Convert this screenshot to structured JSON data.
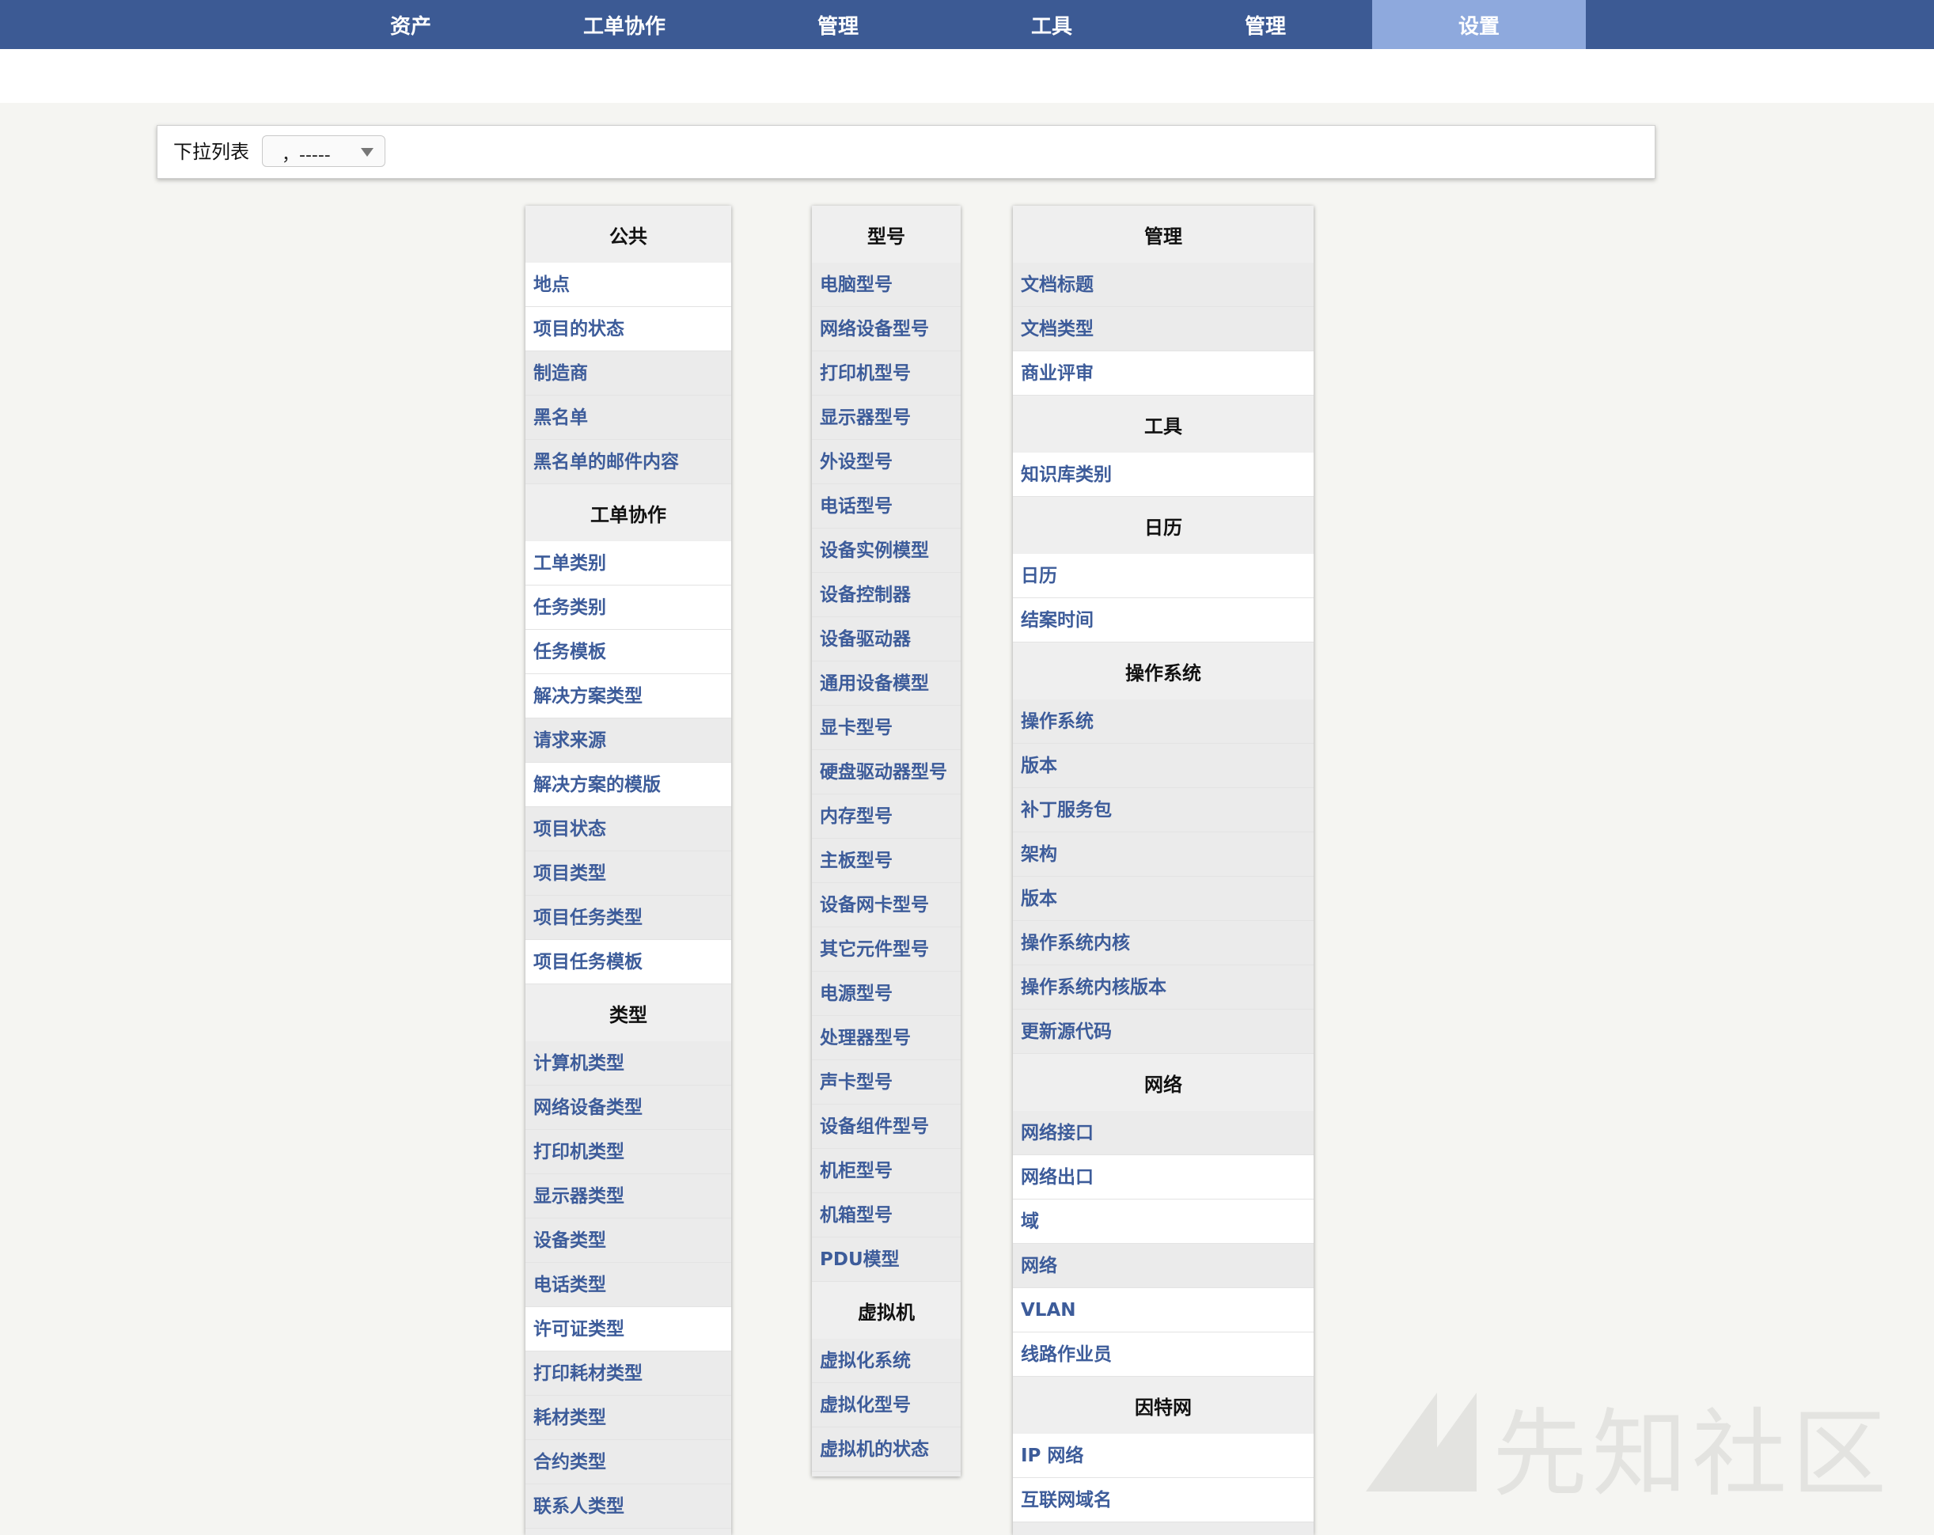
{
  "nav": {
    "items": [
      "资产",
      "工单协作",
      "管理",
      "工具",
      "管理",
      "设置"
    ],
    "active_index": 5
  },
  "dropdown": {
    "label": "下拉列表",
    "value": "，-----"
  },
  "columns": [
    {
      "sections": [
        {
          "title": "公共",
          "items": [
            "地点",
            "项目的状态",
            "制造商",
            "黑名单",
            "黑名单的邮件内容"
          ]
        },
        {
          "title": "工单协作",
          "items": [
            "工单类别",
            "任务类别",
            "任务模板",
            "解决方案类型",
            "请求来源",
            "解决方案的模版",
            "项目状态",
            "项目类型",
            "项目任务类型",
            "项目任务模板"
          ]
        },
        {
          "title": "类型",
          "items": [
            "计算机类型",
            "网络设备类型",
            "打印机类型",
            "显示器类型",
            "设备类型",
            "电话类型",
            "许可证类型",
            "打印耗材类型",
            "耗材类型",
            "合约类型",
            "联系人类型"
          ]
        }
      ]
    },
    {
      "sections": [
        {
          "title": "型号",
          "items": [
            "电脑型号",
            "网络设备型号",
            "打印机型号",
            "显示器型号",
            "外设型号",
            "电话型号",
            "设备实例模型",
            "设备控制器",
            "设备驱动器",
            "通用设备模型",
            "显卡型号",
            "硬盘驱动器型号",
            "内存型号",
            "主板型号",
            "设备网卡型号",
            "其它元件型号",
            "电源型号",
            "处理器型号",
            "声卡型号",
            "设备组件型号",
            "机柜型号",
            "机箱型号",
            "PDU模型"
          ]
        },
        {
          "title": "虚拟机",
          "items": [
            "虚拟化系统",
            "虚拟化型号",
            "虚拟机的状态"
          ]
        }
      ]
    },
    {
      "sections": [
        {
          "title": "管理",
          "items": [
            "文档标题",
            "文档类型",
            "商业评审"
          ]
        },
        {
          "title": "工具",
          "items": [
            "知识库类别"
          ]
        },
        {
          "title": "日历",
          "items": [
            "日历",
            "结案时间"
          ]
        },
        {
          "title": "操作系统",
          "items": [
            "操作系统",
            "版本",
            "补丁服务包",
            "架构",
            "版本",
            "操作系统内核",
            "操作系统内核版本",
            "更新源代码"
          ]
        },
        {
          "title": "网络",
          "items": [
            "网络接口",
            "网络出口",
            "域",
            "网络",
            "VLAN",
            "线路作业员"
          ]
        },
        {
          "title": "因特网",
          "items": [
            "IP 网络",
            "互联网域名"
          ]
        }
      ]
    }
  ],
  "row_shades": [
    [
      "w",
      "w",
      "g",
      "g",
      "g",
      "w",
      "w",
      "w",
      "w",
      "g",
      "w",
      "g",
      "g",
      "g",
      "w",
      "g",
      "g",
      "g",
      "g",
      "g",
      "g",
      "w",
      "g",
      "g",
      "g",
      "g"
    ],
    [
      "g",
      "g",
      "g",
      "g",
      "g",
      "g",
      "g",
      "g",
      "g",
      "g",
      "g",
      "g",
      "g",
      "g",
      "g",
      "g",
      "g",
      "g",
      "g",
      "g",
      "g",
      "g",
      "g",
      "g",
      "g",
      "g"
    ],
    [
      "g",
      "g",
      "w",
      "w",
      "w",
      "w",
      "g",
      "g",
      "g",
      "g",
      "g",
      "g",
      "g",
      "g",
      "g",
      "w",
      "w",
      "g",
      "w",
      "w",
      "w",
      "w"
    ]
  ],
  "watermark": {
    "text": "先知社区"
  }
}
